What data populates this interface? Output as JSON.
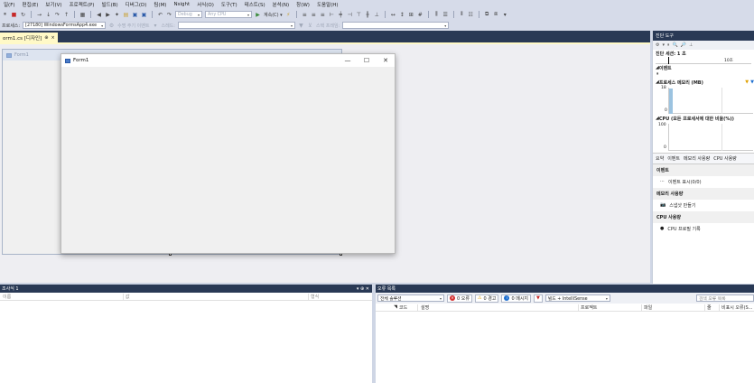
{
  "menu": [
    "일(F)",
    "편집(E)",
    "보기(V)",
    "프로젝트(P)",
    "빌드(B)",
    "디버그(D)",
    "팀(M)",
    "Nsight",
    "서식(O)",
    "도구(T)",
    "테스트(S)",
    "분석(N)",
    "창(W)",
    "도움말(H)"
  ],
  "toolbar1": {
    "config": "Debug",
    "platform": "Any CPU",
    "continue_label": "계속(C) ▾"
  },
  "toolbar2": {
    "process_label": "프로세스:",
    "process_value": "[27180] WindowsFormsApp4.exe",
    "lifecycle_label": "수명 주기 이벤트",
    "thread_label": "스레드:",
    "stack_label": "스택 프레임:"
  },
  "doc_tab": {
    "label": "orm1.cs [디자인]",
    "pin": "⊕",
    "close": "×"
  },
  "bg_form": {
    "title": "Form1"
  },
  "fg_form": {
    "title": "Form1",
    "minimize": "—",
    "maximize": "☐",
    "close": "✕"
  },
  "diagnostics": {
    "title": "진단 도구",
    "session": "진단 세션: 1 초",
    "timeline_tick": "10초",
    "events_label": "이벤트",
    "memory_label": "프로세스 메모리 (MB)",
    "memory_max": "18",
    "memory_min": "0",
    "cpu_label": "CPU (모든 프로세서에 대한 비율(%))",
    "cpu_max": "100",
    "cpu_min": "0",
    "tabs": [
      "요약",
      "이벤트",
      "메모리 사용량",
      "CPU 사용량"
    ],
    "events_section": "이벤트",
    "events_link": "이벤트 표시(0/0)",
    "memory_section": "메모리 사용량",
    "snapshot_link": "스냅샷 만들기",
    "cpu_section": "CPU 사용량",
    "cpu_link": "CPU 프로필 기록"
  },
  "watch": {
    "title": "조사식 1",
    "pin": "▾ ⊕ ✕",
    "col_name": "이름",
    "col_value": "값",
    "col_type": "형식"
  },
  "errors": {
    "title": "오류 목록",
    "scope": "전체 솔루션",
    "errors_count": "0 오류",
    "warnings_count": "0 경고",
    "messages_count": "0 메시지",
    "build_filter": "빌드 + IntelliSense",
    "search_placeholder": "검색 오류 목록",
    "col_code": "코드",
    "col_desc": "설명",
    "col_project": "프로젝트",
    "col_file": "파일",
    "col_line": "줄",
    "col_suppress": "비표시 오류(S..."
  }
}
